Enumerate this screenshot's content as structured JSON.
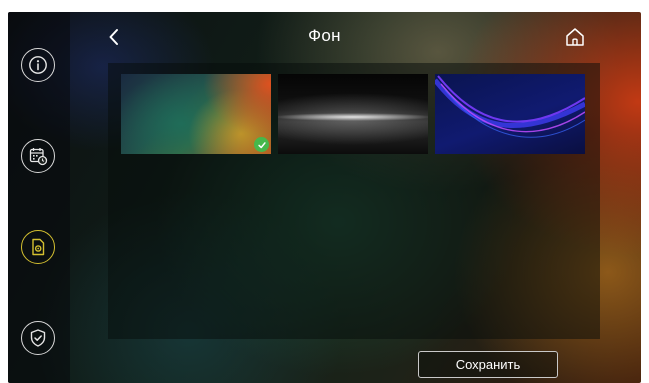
{
  "header": {
    "title": "Фон"
  },
  "sidebar": {
    "items": [
      {
        "icon": "info-icon",
        "active": false
      },
      {
        "icon": "calendar-clock-icon",
        "active": false
      },
      {
        "icon": "wallpaper-settings-icon",
        "active": true
      },
      {
        "icon": "shield-check-icon",
        "active": false
      }
    ]
  },
  "wallpapers": [
    {
      "name": "abstract-gradient",
      "selected": true
    },
    {
      "name": "dark-light-streak",
      "selected": false
    },
    {
      "name": "blue-waves",
      "selected": false
    }
  ],
  "footer": {
    "save_label": "Сохранить"
  },
  "colors": {
    "accent_active": "#d4c030",
    "selected_check": "#46b84b"
  }
}
